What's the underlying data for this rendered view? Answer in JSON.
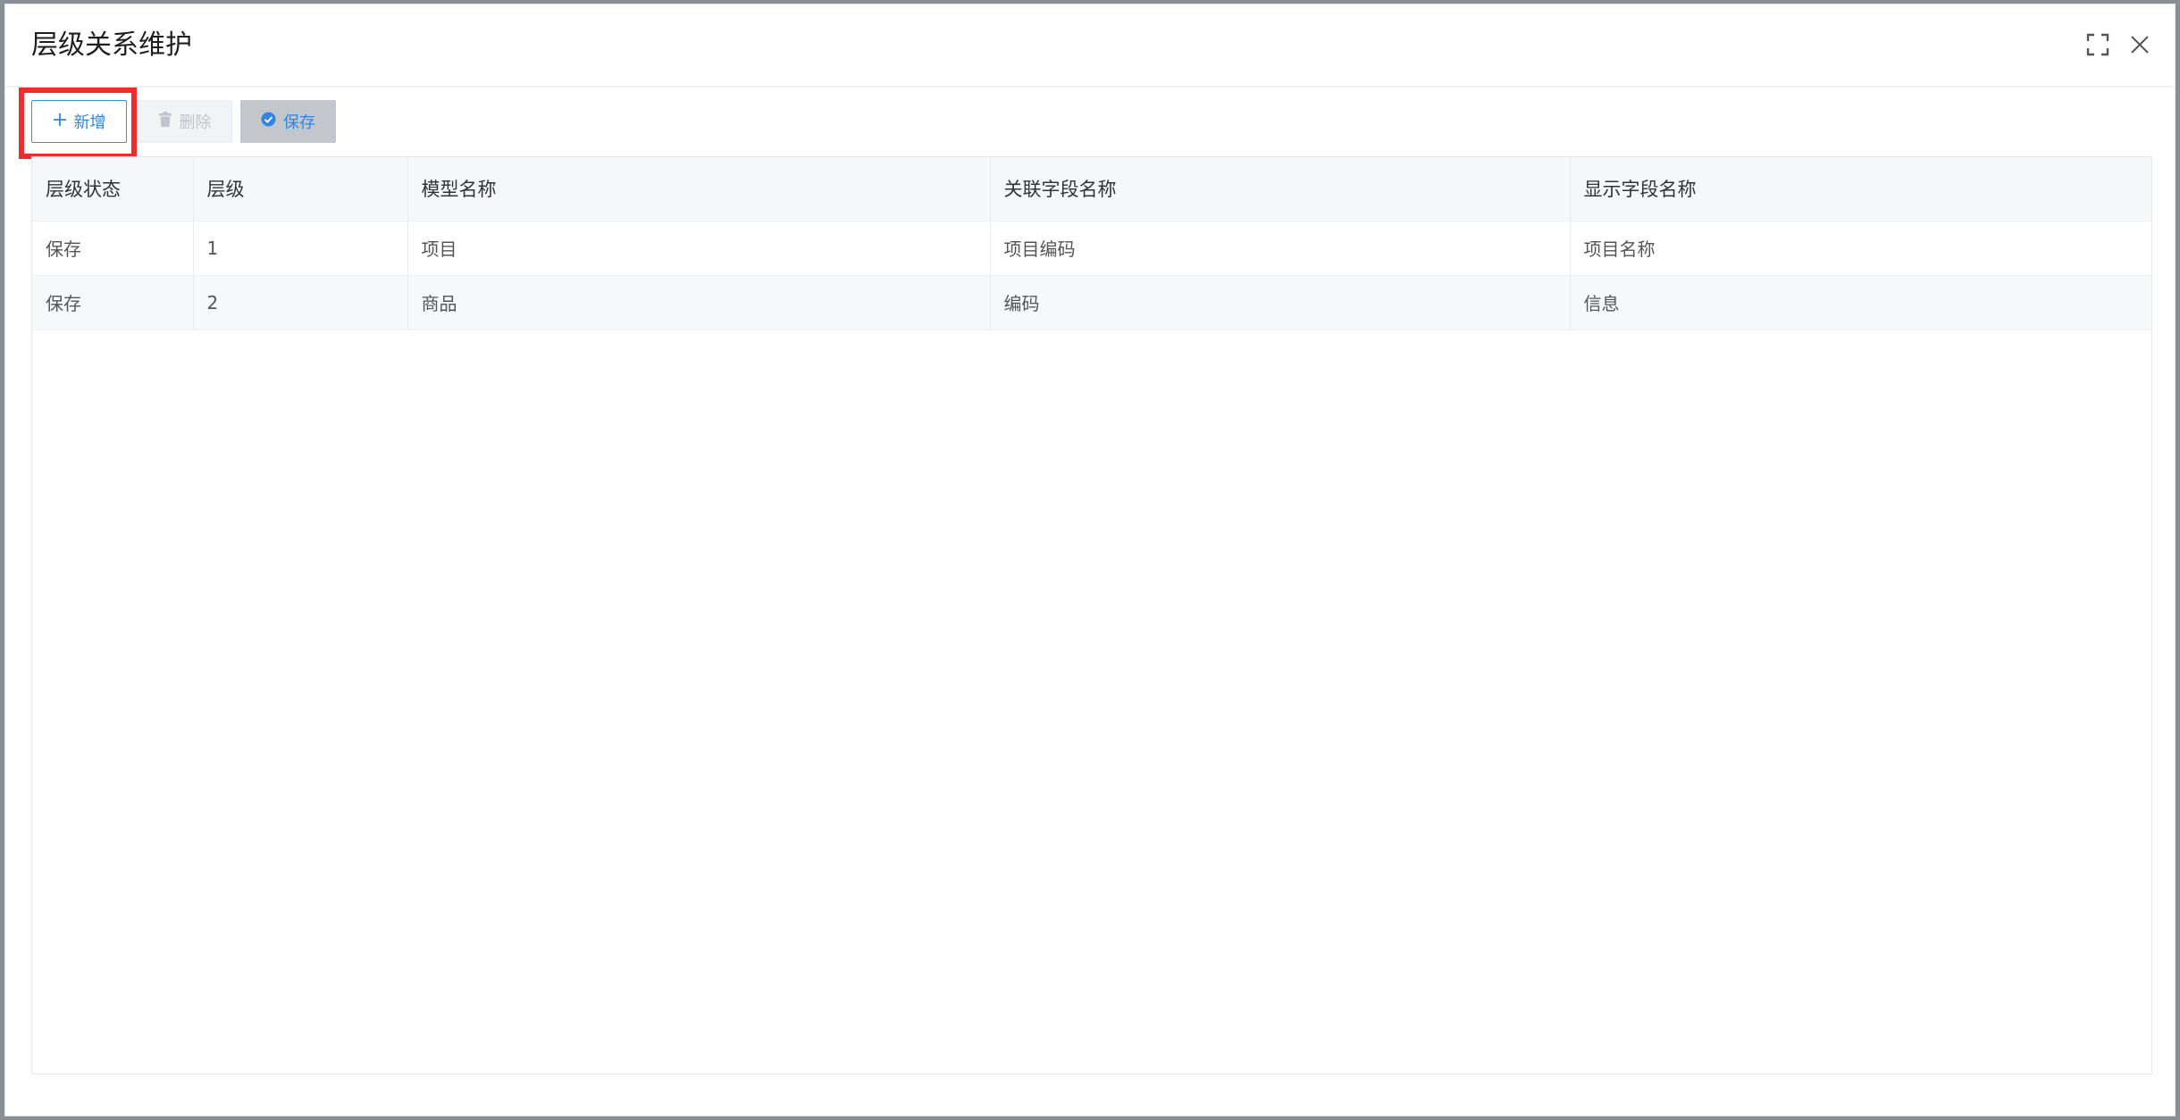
{
  "modal": {
    "title": "层级关系维护",
    "maximize_icon": "maximize-icon",
    "close_icon": "close-icon"
  },
  "toolbar": {
    "add_label": "新增",
    "add_icon": "plus-icon",
    "delete_label": "删除",
    "delete_icon": "trash-icon",
    "save_label": "保存",
    "save_icon": "check-circle-icon"
  },
  "colors": {
    "accent": "#2f86e0",
    "highlight": "#ee2c2c"
  },
  "table": {
    "columns": [
      "层级状态",
      "层级",
      "模型名称",
      "关联字段名称",
      "显示字段名称"
    ],
    "rows": [
      [
        "保存",
        "1",
        "项目",
        "项目编码",
        "项目名称"
      ],
      [
        "保存",
        "2",
        "商品",
        "编码",
        "信息"
      ]
    ]
  }
}
